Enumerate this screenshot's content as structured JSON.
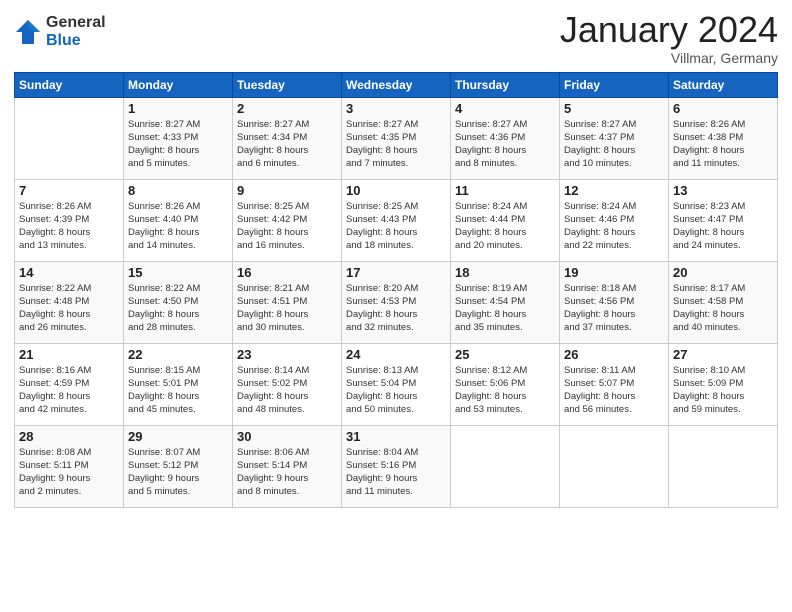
{
  "logo": {
    "general": "General",
    "blue": "Blue"
  },
  "title": "January 2024",
  "location": "Villmar, Germany",
  "days_header": [
    "Sunday",
    "Monday",
    "Tuesday",
    "Wednesday",
    "Thursday",
    "Friday",
    "Saturday"
  ],
  "weeks": [
    [
      {
        "num": "",
        "info": ""
      },
      {
        "num": "1",
        "info": "Sunrise: 8:27 AM\nSunset: 4:33 PM\nDaylight: 8 hours\nand 5 minutes."
      },
      {
        "num": "2",
        "info": "Sunrise: 8:27 AM\nSunset: 4:34 PM\nDaylight: 8 hours\nand 6 minutes."
      },
      {
        "num": "3",
        "info": "Sunrise: 8:27 AM\nSunset: 4:35 PM\nDaylight: 8 hours\nand 7 minutes."
      },
      {
        "num": "4",
        "info": "Sunrise: 8:27 AM\nSunset: 4:36 PM\nDaylight: 8 hours\nand 8 minutes."
      },
      {
        "num": "5",
        "info": "Sunrise: 8:27 AM\nSunset: 4:37 PM\nDaylight: 8 hours\nand 10 minutes."
      },
      {
        "num": "6",
        "info": "Sunrise: 8:26 AM\nSunset: 4:38 PM\nDaylight: 8 hours\nand 11 minutes."
      }
    ],
    [
      {
        "num": "7",
        "info": "Sunrise: 8:26 AM\nSunset: 4:39 PM\nDaylight: 8 hours\nand 13 minutes."
      },
      {
        "num": "8",
        "info": "Sunrise: 8:26 AM\nSunset: 4:40 PM\nDaylight: 8 hours\nand 14 minutes."
      },
      {
        "num": "9",
        "info": "Sunrise: 8:25 AM\nSunset: 4:42 PM\nDaylight: 8 hours\nand 16 minutes."
      },
      {
        "num": "10",
        "info": "Sunrise: 8:25 AM\nSunset: 4:43 PM\nDaylight: 8 hours\nand 18 minutes."
      },
      {
        "num": "11",
        "info": "Sunrise: 8:24 AM\nSunset: 4:44 PM\nDaylight: 8 hours\nand 20 minutes."
      },
      {
        "num": "12",
        "info": "Sunrise: 8:24 AM\nSunset: 4:46 PM\nDaylight: 8 hours\nand 22 minutes."
      },
      {
        "num": "13",
        "info": "Sunrise: 8:23 AM\nSunset: 4:47 PM\nDaylight: 8 hours\nand 24 minutes."
      }
    ],
    [
      {
        "num": "14",
        "info": "Sunrise: 8:22 AM\nSunset: 4:48 PM\nDaylight: 8 hours\nand 26 minutes."
      },
      {
        "num": "15",
        "info": "Sunrise: 8:22 AM\nSunset: 4:50 PM\nDaylight: 8 hours\nand 28 minutes."
      },
      {
        "num": "16",
        "info": "Sunrise: 8:21 AM\nSunset: 4:51 PM\nDaylight: 8 hours\nand 30 minutes."
      },
      {
        "num": "17",
        "info": "Sunrise: 8:20 AM\nSunset: 4:53 PM\nDaylight: 8 hours\nand 32 minutes."
      },
      {
        "num": "18",
        "info": "Sunrise: 8:19 AM\nSunset: 4:54 PM\nDaylight: 8 hours\nand 35 minutes."
      },
      {
        "num": "19",
        "info": "Sunrise: 8:18 AM\nSunset: 4:56 PM\nDaylight: 8 hours\nand 37 minutes."
      },
      {
        "num": "20",
        "info": "Sunrise: 8:17 AM\nSunset: 4:58 PM\nDaylight: 8 hours\nand 40 minutes."
      }
    ],
    [
      {
        "num": "21",
        "info": "Sunrise: 8:16 AM\nSunset: 4:59 PM\nDaylight: 8 hours\nand 42 minutes."
      },
      {
        "num": "22",
        "info": "Sunrise: 8:15 AM\nSunset: 5:01 PM\nDaylight: 8 hours\nand 45 minutes."
      },
      {
        "num": "23",
        "info": "Sunrise: 8:14 AM\nSunset: 5:02 PM\nDaylight: 8 hours\nand 48 minutes."
      },
      {
        "num": "24",
        "info": "Sunrise: 8:13 AM\nSunset: 5:04 PM\nDaylight: 8 hours\nand 50 minutes."
      },
      {
        "num": "25",
        "info": "Sunrise: 8:12 AM\nSunset: 5:06 PM\nDaylight: 8 hours\nand 53 minutes."
      },
      {
        "num": "26",
        "info": "Sunrise: 8:11 AM\nSunset: 5:07 PM\nDaylight: 8 hours\nand 56 minutes."
      },
      {
        "num": "27",
        "info": "Sunrise: 8:10 AM\nSunset: 5:09 PM\nDaylight: 8 hours\nand 59 minutes."
      }
    ],
    [
      {
        "num": "28",
        "info": "Sunrise: 8:08 AM\nSunset: 5:11 PM\nDaylight: 9 hours\nand 2 minutes."
      },
      {
        "num": "29",
        "info": "Sunrise: 8:07 AM\nSunset: 5:12 PM\nDaylight: 9 hours\nand 5 minutes."
      },
      {
        "num": "30",
        "info": "Sunrise: 8:06 AM\nSunset: 5:14 PM\nDaylight: 9 hours\nand 8 minutes."
      },
      {
        "num": "31",
        "info": "Sunrise: 8:04 AM\nSunset: 5:16 PM\nDaylight: 9 hours\nand 11 minutes."
      },
      {
        "num": "",
        "info": ""
      },
      {
        "num": "",
        "info": ""
      },
      {
        "num": "",
        "info": ""
      }
    ]
  ]
}
